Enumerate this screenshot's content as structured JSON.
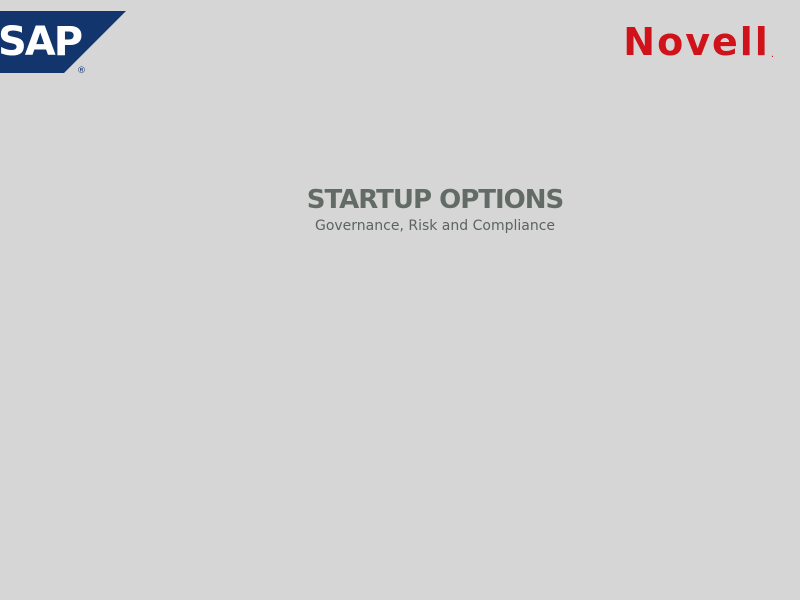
{
  "logos": {
    "sap": {
      "text": "SAP",
      "registered_mark": "®",
      "colors": {
        "background": "#13356e",
        "text": "#ffffff",
        "mark": "#13356e"
      }
    },
    "novell": {
      "text": "Novell",
      "dot": ".",
      "color": "#d0121b"
    }
  },
  "heading": {
    "title": "STARTUP OPTIONS",
    "subtitle": "Governance, Risk and Compliance",
    "title_color": "#636b66",
    "subtitle_color": "#5c645f"
  },
  "colors": {
    "background": "#d6d6d6"
  }
}
